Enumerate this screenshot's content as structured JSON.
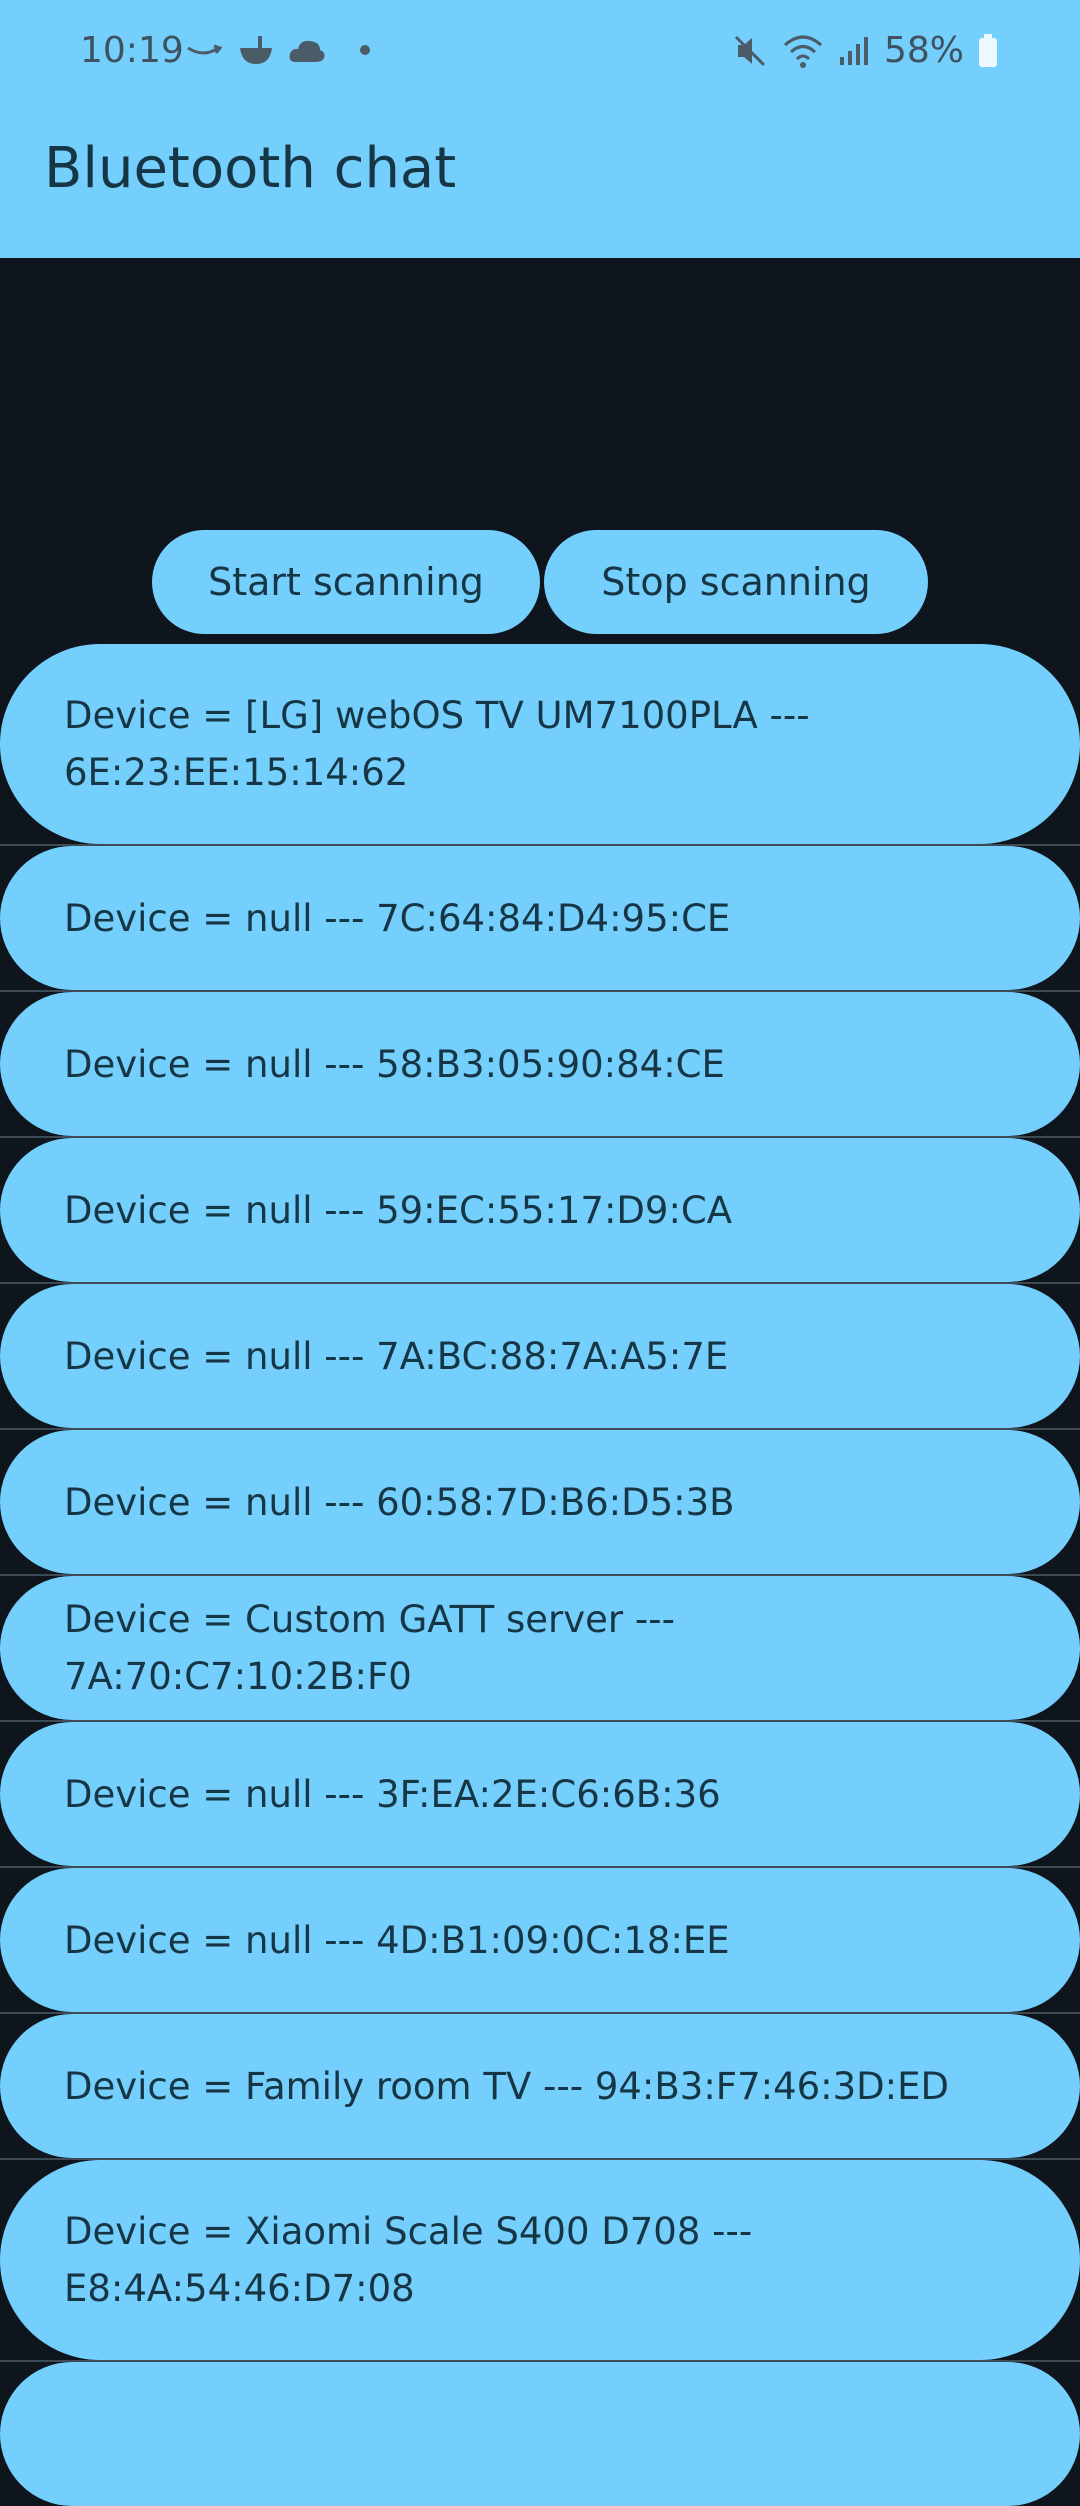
{
  "status": {
    "time": "10:19",
    "battery": "58%",
    "left_icons": [
      "amazon-icon",
      "bowl-icon",
      "cloud-icon"
    ],
    "right_icons": [
      "mute-icon",
      "wifi-icon",
      "signal-icon",
      "battery-icon"
    ]
  },
  "app": {
    "title": "Bluetooth chat",
    "accent": "#74cffc",
    "background": "#0e151c"
  },
  "buttons": {
    "start": "Start scanning",
    "stop": "Stop scanning"
  },
  "devices": [
    "Device = [LG] webOS TV UM7100PLA --- 6E:23:EE:15:14:62",
    "Device = null --- 7C:64:84:D4:95:CE",
    "Device = null --- 58:B3:05:90:84:CE",
    "Device = null --- 59:EC:55:17:D9:CA",
    "Device = null --- 7A:BC:88:7A:A5:7E",
    "Device = null --- 60:58:7D:B6:D5:3B",
    "Device = Custom GATT server --- 7A:70:C7:10:2B:F0",
    "Device = null --- 3F:EA:2E:C6:6B:36",
    "Device = null --- 4D:B1:09:0C:18:EE",
    "Device = Family room TV --- 94:B3:F7:46:3D:ED",
    "Device = Xiaomi Scale S400 D708 --- E8:4A:54:46:D7:08"
  ]
}
